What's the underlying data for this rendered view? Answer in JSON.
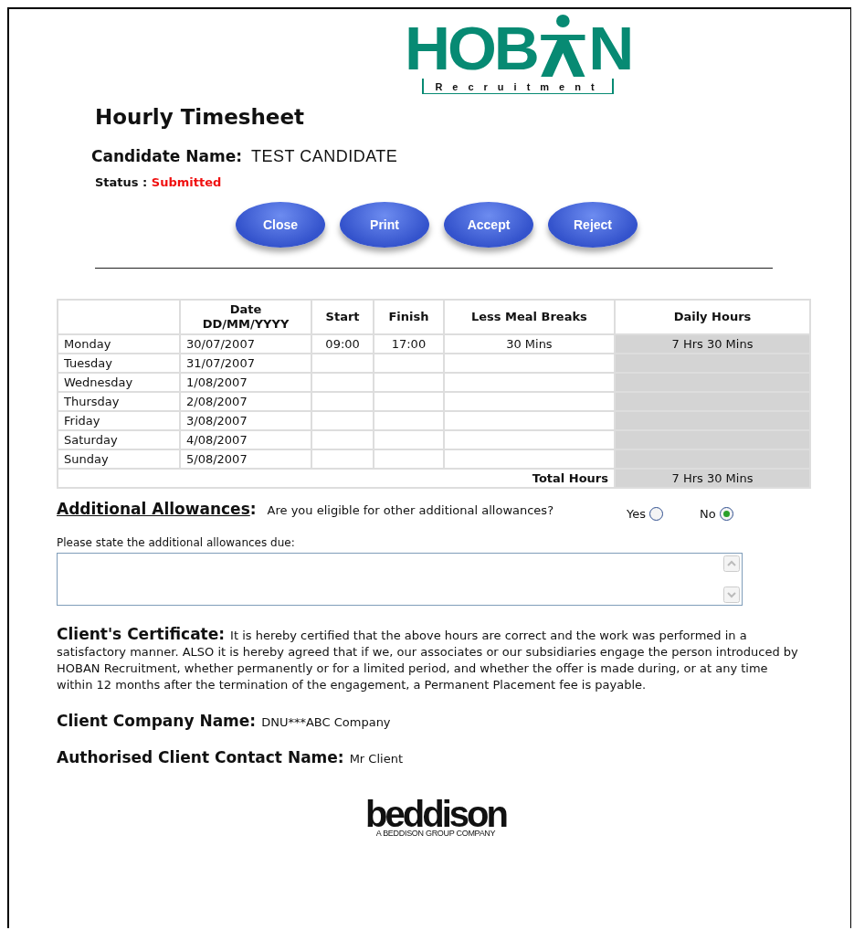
{
  "logo": {
    "text_before": "HOB",
    "text_after": "N",
    "tagline": "Recruitment"
  },
  "title": "Hourly Timesheet",
  "candidate": {
    "label": "Candidate Name:",
    "value": "TEST CANDIDATE"
  },
  "status": {
    "label": "Status :",
    "value": "Submitted"
  },
  "buttons": [
    "Close",
    "Print",
    "Accept",
    "Reject"
  ],
  "table": {
    "columns": [
      "",
      "Date\nDD/MM/YYYY",
      "Start",
      "Finish",
      "Less Meal Breaks",
      "Daily Hours"
    ],
    "rows": [
      {
        "day": "Monday",
        "date": "30/07/2007",
        "start": "09:00",
        "finish": "17:00",
        "breaks": "30 Mins",
        "daily": "7 Hrs 30 Mins"
      },
      {
        "day": "Tuesday",
        "date": "31/07/2007"
      },
      {
        "day": "Wednesday",
        "date": "1/08/2007"
      },
      {
        "day": "Thursday",
        "date": "2/08/2007"
      },
      {
        "day": "Friday",
        "date": "3/08/2007"
      },
      {
        "day": "Saturday",
        "date": "4/08/2007"
      },
      {
        "day": "Sunday",
        "date": "5/08/2007"
      }
    ],
    "total_label": "Total Hours",
    "total_value": "7 Hrs 30 Mins"
  },
  "allowances": {
    "heading": "Additional Allowances",
    "colon": ":",
    "question": "Are you eligible for other additional allowances?",
    "options": [
      {
        "label": "Yes",
        "selected": false
      },
      {
        "label": "No",
        "selected": true
      }
    ],
    "field_label": "Please state the additional allowances due:"
  },
  "certificate": {
    "heading": "Client's Certificate:",
    "text": "It is hereby certified that the above hours are correct and the work was performed in a satisfactory manner. ALSO it is hereby agreed that if we, our associates or our subsidiaries engage the person introduced by HOBAN Recruitment, whether permanently or for a limited period, and whether the offer is made during, or at any time within 12 months after the termination of the engagement, a Permanent Placement fee is payable."
  },
  "client_company": {
    "label": "Client Company Name:",
    "value": "DNU***ABC Company"
  },
  "client_contact": {
    "label": "Authorised Client Contact Name:",
    "value": "Mr Client"
  },
  "footer_logo": {
    "name": "beddison",
    "tagline": "A BEDDISON GROUP COMPANY"
  }
}
